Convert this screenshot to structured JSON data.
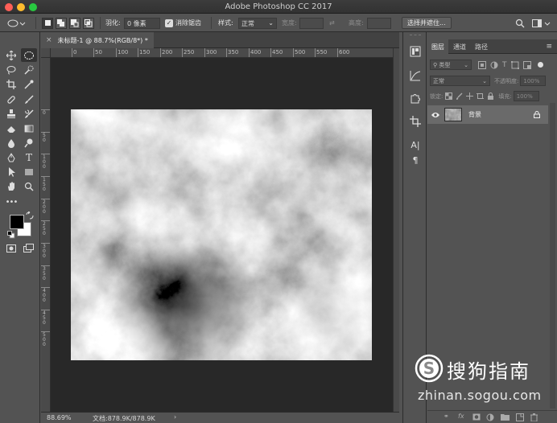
{
  "titlebar": {
    "title": "Adobe Photoshop CC 2017"
  },
  "options": {
    "feather_label": "羽化:",
    "feather_value": "0 像素",
    "antialias_label": "消除锯齿",
    "style_label": "样式:",
    "style_value": "正常",
    "width_label": "宽度:",
    "height_label": "高度:",
    "select_mask_button": "选择并遮住..."
  },
  "document": {
    "tab_title": "未标题-1 @ 88.7%(RGB/8*) *",
    "ruler_h": [
      "0",
      "50",
      "100",
      "150",
      "200",
      "250",
      "300",
      "350",
      "400",
      "450",
      "500",
      "550",
      "600"
    ],
    "ruler_v": [
      "0",
      "5 0",
      "1 0 0",
      "1 5 0",
      "2 0 0",
      "2 5 0",
      "3 0 0",
      "3 5 0",
      "4 0 0",
      "4 5 0",
      "5 0 0"
    ]
  },
  "status": {
    "zoom": "88.69%",
    "doc_info": "文档:878.9K/878.9K"
  },
  "panel": {
    "tabs": [
      "图层",
      "通道",
      "路径"
    ],
    "filter_kind": "类型",
    "blend_mode": "正常",
    "opacity_label": "不透明度:",
    "opacity_value": "100%",
    "lock_label": "锁定:",
    "fill_label": "填充:",
    "fill_value": "100%",
    "layer_name": "背景"
  },
  "watermark": {
    "brand_cn": "搜狗指南",
    "url": "zhinan.sogou.com"
  }
}
